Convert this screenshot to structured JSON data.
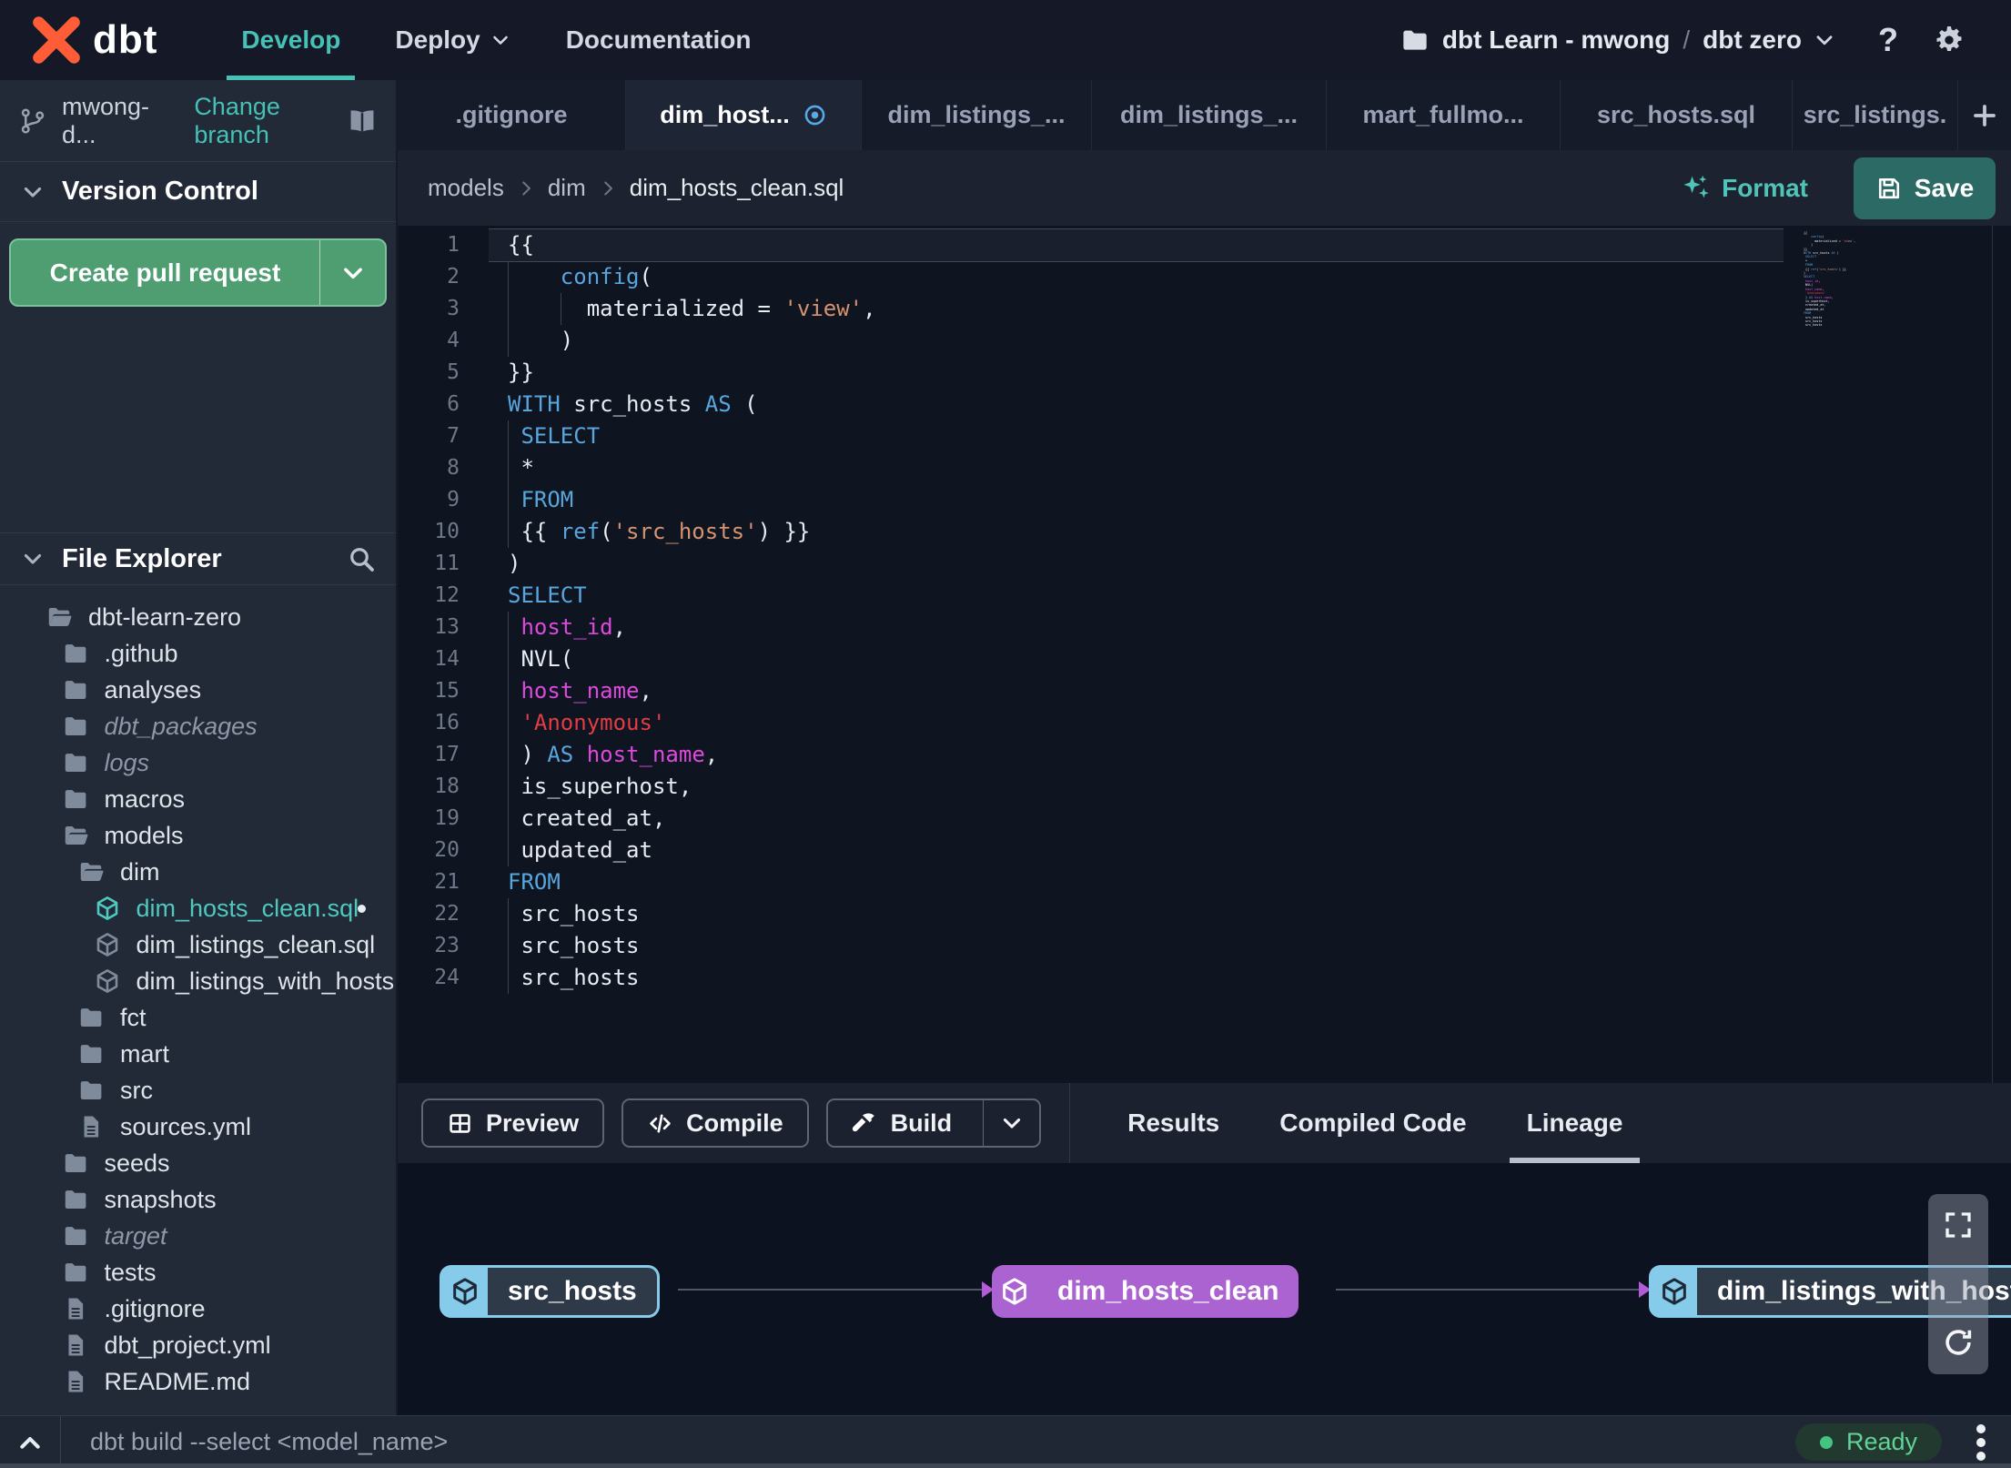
{
  "colors": {
    "accent_teal": "#45c1b6",
    "logo_orange": "#ff5d38",
    "pr_button_green": "#4f9e72",
    "save_button_teal": "#2c6a66",
    "code_keyword_blue": "#58a6dd",
    "code_string_salmon": "#d6936f",
    "code_string_red": "#e23c44",
    "code_identifier_magenta": "#dd49dd",
    "lineage_source_blue": "#86cbe9",
    "lineage_model_purple": "#ab63d1",
    "status_ready_green": "#45c383"
  },
  "topnav": {
    "logo_text": "dbt",
    "items": [
      {
        "label": "Develop",
        "active": true,
        "chevron": false
      },
      {
        "label": "Deploy",
        "active": false,
        "chevron": true
      },
      {
        "label": "Documentation",
        "active": false,
        "chevron": false
      }
    ],
    "project": {
      "account": "dbt Learn - mwong",
      "separator": "/",
      "name": "dbt zero"
    },
    "help_label": "?"
  },
  "sidebar": {
    "branch": {
      "name": "mwong-d...",
      "action_label": "Change branch"
    },
    "version_control": {
      "title": "Version Control",
      "create_pr_label": "Create pull request"
    },
    "file_explorer": {
      "title": "File Explorer",
      "tree": [
        {
          "label": "dbt-learn-zero",
          "icon": "folder-open",
          "depth": 0
        },
        {
          "label": ".github",
          "icon": "folder",
          "depth": 1
        },
        {
          "label": "analyses",
          "icon": "folder",
          "depth": 1
        },
        {
          "label": "dbt_packages",
          "icon": "folder",
          "depth": 1,
          "dim": true
        },
        {
          "label": "logs",
          "icon": "folder",
          "depth": 1,
          "dim": true
        },
        {
          "label": "macros",
          "icon": "folder",
          "depth": 1
        },
        {
          "label": "models",
          "icon": "folder-open",
          "depth": 1
        },
        {
          "label": "dim",
          "icon": "folder-open",
          "depth": 2
        },
        {
          "label": "dim_hosts_clean.sql",
          "icon": "model",
          "depth": 3,
          "selected": true,
          "modified": true
        },
        {
          "label": "dim_listings_clean.sql",
          "icon": "model",
          "depth": 3
        },
        {
          "label": "dim_listings_with_hosts...",
          "icon": "model",
          "depth": 3
        },
        {
          "label": "fct",
          "icon": "folder",
          "depth": 2
        },
        {
          "label": "mart",
          "icon": "folder",
          "depth": 2
        },
        {
          "label": "src",
          "icon": "folder",
          "depth": 2
        },
        {
          "label": "sources.yml",
          "icon": "file",
          "depth": 2
        },
        {
          "label": "seeds",
          "icon": "folder",
          "depth": 1
        },
        {
          "label": "snapshots",
          "icon": "folder",
          "depth": 1
        },
        {
          "label": "target",
          "icon": "folder",
          "depth": 1,
          "dim": true
        },
        {
          "label": "tests",
          "icon": "folder",
          "depth": 1
        },
        {
          "label": ".gitignore",
          "icon": "file",
          "depth": 1
        },
        {
          "label": "dbt_project.yml",
          "icon": "file",
          "depth": 1
        },
        {
          "label": "README.md",
          "icon": "file",
          "depth": 1
        }
      ]
    }
  },
  "editor": {
    "tabs": [
      {
        "label": ".gitignore"
      },
      {
        "label": "dim_host...",
        "active": true,
        "modified": true
      },
      {
        "label": "dim_listings_..."
      },
      {
        "label": "dim_listings_..."
      },
      {
        "label": "mart_fullmo..."
      },
      {
        "label": "src_hosts.sql"
      },
      {
        "label": "src_listings."
      }
    ],
    "new_tab_label": "+",
    "breadcrumb": [
      "models",
      "dim",
      "dim_hosts_clean.sql"
    ],
    "format_label": "Format",
    "save_label": "Save",
    "code_lines": [
      {
        "n": 1,
        "cur": true,
        "g": [],
        "t": [
          [
            "p",
            "{{"
          ]
        ]
      },
      {
        "n": 2,
        "g": [
          0
        ],
        "t": [
          [
            "p",
            "    "
          ],
          [
            "k",
            "config"
          ],
          [
            "p",
            "("
          ]
        ]
      },
      {
        "n": 3,
        "g": [
          0,
          4
        ],
        "t": [
          [
            "p",
            "      materialized = "
          ],
          [
            "s",
            "'view'"
          ],
          [
            "p",
            ","
          ]
        ]
      },
      {
        "n": 4,
        "g": [
          0
        ],
        "t": [
          [
            "p",
            "    )"
          ]
        ]
      },
      {
        "n": 5,
        "g": [],
        "t": [
          [
            "p",
            "}}"
          ]
        ]
      },
      {
        "n": 6,
        "g": [],
        "t": [
          [
            "k",
            "WITH"
          ],
          [
            "p",
            " src_hosts "
          ],
          [
            "k",
            "AS"
          ],
          [
            "p",
            " ("
          ]
        ]
      },
      {
        "n": 7,
        "g": [
          0
        ],
        "t": [
          [
            "p",
            " "
          ],
          [
            "k",
            "SELECT"
          ]
        ]
      },
      {
        "n": 8,
        "g": [
          0
        ],
        "t": [
          [
            "p",
            " *"
          ]
        ]
      },
      {
        "n": 9,
        "g": [
          0
        ],
        "t": [
          [
            "p",
            " "
          ],
          [
            "k",
            "FROM"
          ]
        ]
      },
      {
        "n": 10,
        "g": [
          0
        ],
        "t": [
          [
            "p",
            " {{ "
          ],
          [
            "k",
            "ref"
          ],
          [
            "p",
            "("
          ],
          [
            "s",
            "'src_hosts'"
          ],
          [
            "p",
            ") }}"
          ]
        ]
      },
      {
        "n": 11,
        "g": [],
        "t": [
          [
            "p",
            ")"
          ]
        ]
      },
      {
        "n": 12,
        "g": [],
        "t": [
          [
            "k",
            "SELECT"
          ]
        ]
      },
      {
        "n": 13,
        "g": [
          0
        ],
        "t": [
          [
            "p",
            " "
          ],
          [
            "m",
            "host_id"
          ],
          [
            "p",
            ","
          ]
        ]
      },
      {
        "n": 14,
        "g": [
          0
        ],
        "t": [
          [
            "p",
            " NVL("
          ]
        ]
      },
      {
        "n": 15,
        "g": [
          0
        ],
        "t": [
          [
            "p",
            " "
          ],
          [
            "m",
            "host_name"
          ],
          [
            "p",
            ","
          ]
        ]
      },
      {
        "n": 16,
        "g": [
          0
        ],
        "t": [
          [
            "p",
            " "
          ],
          [
            "r",
            "'Anonymous'"
          ]
        ]
      },
      {
        "n": 17,
        "g": [
          0
        ],
        "t": [
          [
            "p",
            " ) "
          ],
          [
            "k",
            "AS"
          ],
          [
            "p",
            " "
          ],
          [
            "m",
            "host_name"
          ],
          [
            "p",
            ","
          ]
        ]
      },
      {
        "n": 18,
        "g": [
          0
        ],
        "t": [
          [
            "p",
            " is_superhost,"
          ]
        ]
      },
      {
        "n": 19,
        "g": [
          0
        ],
        "t": [
          [
            "p",
            " created_at,"
          ]
        ]
      },
      {
        "n": 20,
        "g": [
          0
        ],
        "t": [
          [
            "p",
            " updated_at"
          ]
        ]
      },
      {
        "n": 21,
        "g": [],
        "t": [
          [
            "k",
            "FROM"
          ]
        ]
      },
      {
        "n": 22,
        "g": [
          0
        ],
        "t": [
          [
            "p",
            " src_hosts"
          ]
        ]
      },
      {
        "n": 23,
        "g": [
          0
        ],
        "t": [
          [
            "p",
            " src_hosts"
          ]
        ]
      },
      {
        "n": 24,
        "g": [
          0
        ],
        "t": [
          [
            "p",
            " src_hosts"
          ]
        ]
      }
    ]
  },
  "bottom_panel": {
    "action_buttons": [
      {
        "label": "Preview",
        "icon": "grid"
      },
      {
        "label": "Compile",
        "icon": "code"
      },
      {
        "label": "Build",
        "icon": "hammer",
        "split": true
      }
    ],
    "tabs": [
      {
        "label": "Results"
      },
      {
        "label": "Compiled Code"
      },
      {
        "label": "Lineage",
        "active": true
      }
    ],
    "lineage_nodes": [
      {
        "label": "src_hosts",
        "style": "source"
      },
      {
        "label": "dim_hosts_clean",
        "style": "model-selected"
      },
      {
        "label": "dim_listings_with_hosts",
        "style": "source"
      }
    ]
  },
  "statusbar": {
    "command": "dbt build --select <model_name>",
    "status_label": "Ready"
  }
}
